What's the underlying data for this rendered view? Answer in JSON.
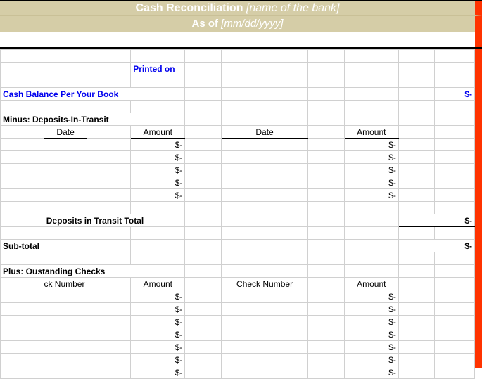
{
  "header": {
    "title_prefix": "Cash Reconciliation ",
    "title_placeholder": "[name of the bank]",
    "asof_prefix": "As of ",
    "asof_placeholder": "[mm/dd/yyyy]"
  },
  "labels": {
    "printed_on": "Printed on",
    "cash_balance": "Cash Balance Per Your Book",
    "minus_deposits": "Minus: Deposits-In-Transit",
    "date": "Date",
    "amount": "Amount",
    "deposits_total": "Deposits in Transit Total",
    "subtotal": "Sub-total",
    "plus_checks": "Plus: Oustanding Checks",
    "check_number": "Check Number",
    "check_number_cut": "Check Number"
  },
  "values": {
    "cash_balance": "$-",
    "deposits_total": "$-",
    "subtotal": "$-",
    "dash": "$-"
  },
  "deposits": {
    "left": [
      "$-",
      "$-",
      "$-",
      "$-",
      "$-"
    ],
    "right": [
      "$-",
      "$-",
      "$-",
      "$-",
      "$-"
    ]
  },
  "checks": {
    "left": [
      "$-",
      "$-",
      "$-",
      "$-",
      "$-",
      "$-",
      "$-"
    ],
    "right": [
      "$-",
      "$-",
      "$-",
      "$-",
      "$-",
      "$-",
      "$-"
    ]
  }
}
